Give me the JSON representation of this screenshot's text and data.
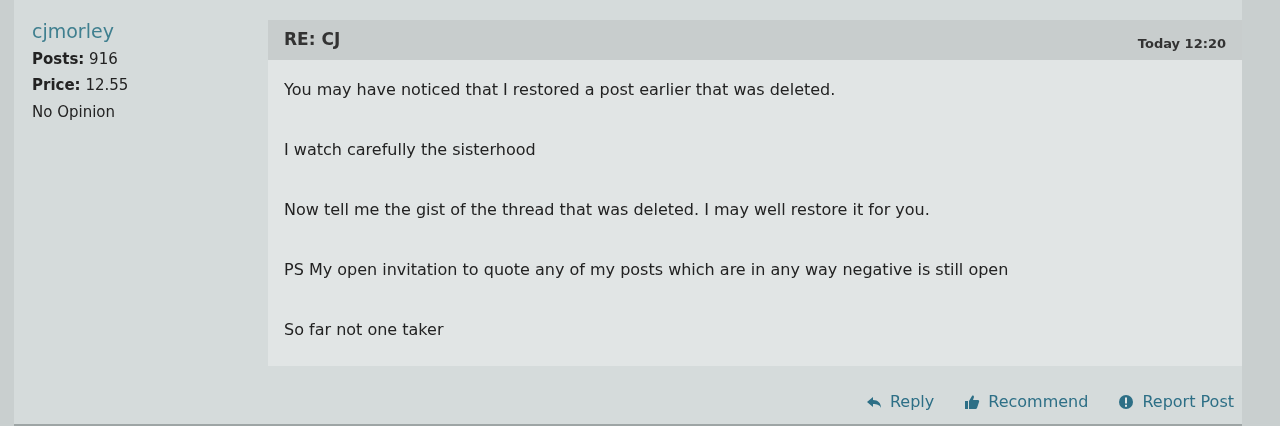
{
  "author": {
    "username": "cjmorley",
    "stats": [
      {
        "label": "Posts:",
        "value": "916"
      },
      {
        "label": "Price:",
        "value": "12.55"
      }
    ],
    "opinion": "No Opinion"
  },
  "post": {
    "title": "RE: CJ",
    "time": "Today 12:20",
    "paragraphs": [
      "You may have noticed that I restored a post earlier that was deleted.",
      "I watch carefully the sisterhood",
      "Now tell me the gist of the thread that was deleted. I may well restore it for you.",
      "PS My open invitation to quote any of my posts which are in any way negative is still open",
      "So far not one taker"
    ]
  },
  "actions": [
    {
      "kind": "reply",
      "label": "Reply"
    },
    {
      "kind": "recommend",
      "label": "Recommend"
    },
    {
      "kind": "report",
      "label": "Report Post"
    }
  ]
}
